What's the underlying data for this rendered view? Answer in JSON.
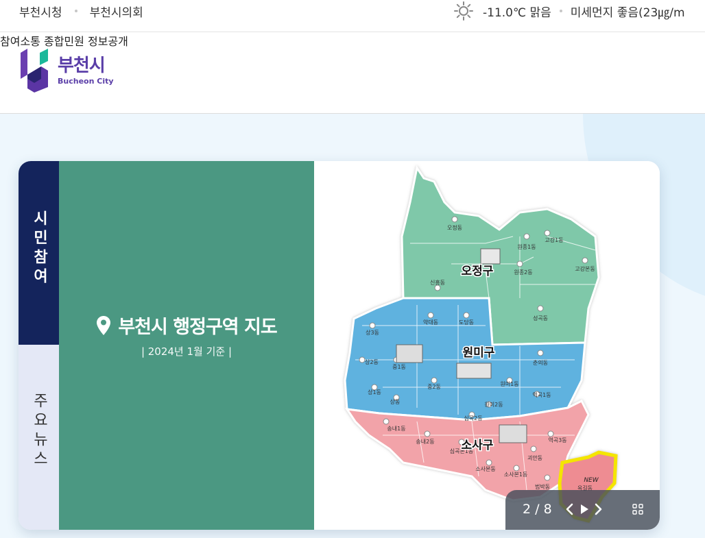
{
  "utility": {
    "links": [
      "부천시청",
      "부천시의회"
    ],
    "temperature": "-11.0℃ 맑음",
    "dust": "미세먼지 좋음(23㎍/m"
  },
  "header": {
    "logo_ko": "부천시",
    "logo_en": "Bucheon City",
    "nav": [
      "참여소통",
      "종합민원",
      "정보공개"
    ]
  },
  "tabs": [
    {
      "label": "시민참여",
      "active": true
    },
    {
      "label": "주요뉴스",
      "active": false
    }
  ],
  "banner": {
    "title": "부천시 행정구역 지도",
    "subtitle": "| 2024년 1월 기준 |"
  },
  "map": {
    "districts": [
      "오정구",
      "원미구",
      "소사구"
    ],
    "dongs": [
      "오정동",
      "원종1동",
      "고강1동",
      "원종2동",
      "고강본동",
      "신흥동",
      "성곡동",
      "심곡동",
      "약대동",
      "도당동",
      "중3동",
      "중4동",
      "상3동",
      "원미동",
      "상2동",
      "중1동",
      "춘의동",
      "상1동",
      "중2동",
      "원미1동",
      "역곡1동",
      "상동",
      "중동",
      "심곡1동",
      "원미2동",
      "심곡3동",
      "심곡2동",
      "역곡2동",
      "소사동",
      "송내1동",
      "송내2동",
      "심곡본1동",
      "심곡본동",
      "역곡3동",
      "괴안동",
      "소사본동",
      "소사본1동",
      "범박동",
      "옥길동"
    ],
    "new_badge": "NEW",
    "colors": {
      "ojeong": "#7fc8a9",
      "wonmi": "#5eb2df",
      "sosa": "#f2a3a9",
      "highlight": "#f4e500"
    }
  },
  "slider": {
    "counter": "2 / 8"
  }
}
